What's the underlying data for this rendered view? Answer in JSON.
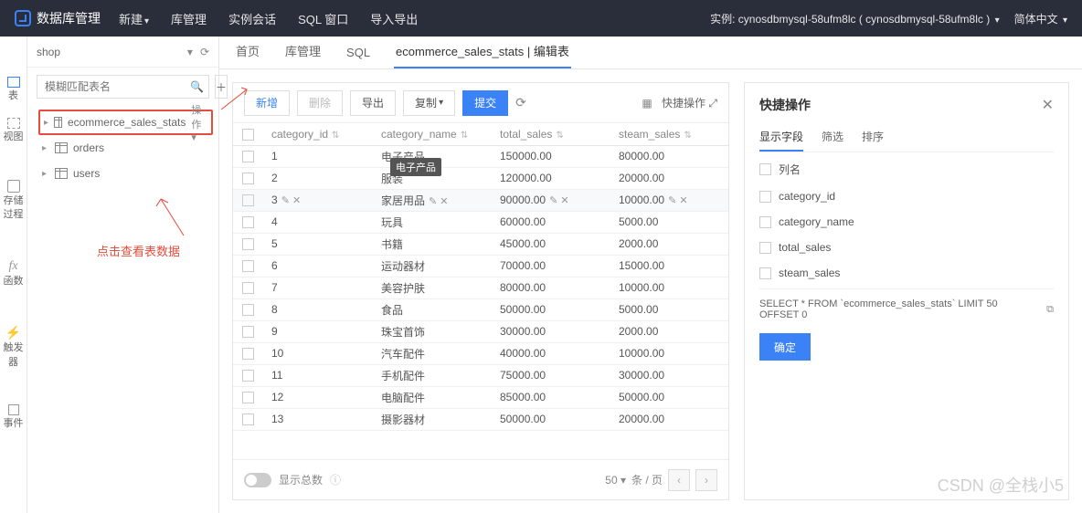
{
  "header": {
    "brand": "数据库管理",
    "menu": [
      "新建",
      "库管理",
      "实例会话",
      "SQL 窗口",
      "导入导出"
    ],
    "instance_label": "实例: cynosdbmysql-58ufm8lc ( cynosdbmysql-58ufm8lc )",
    "lang": "简体中文"
  },
  "sidebar": {
    "db": "shop",
    "search_placeholder": "模糊匹配表名",
    "tables": [
      {
        "name": "ecommerce_sales_stats",
        "action": "操作",
        "highlight": true
      },
      {
        "name": "orders"
      },
      {
        "name": "users"
      }
    ],
    "annotation": "点击查看表数据"
  },
  "rail": {
    "items": [
      "表",
      "视图",
      "存储过程",
      "函数",
      "触发器",
      "事件"
    ]
  },
  "tabs": {
    "items": [
      {
        "label": "首页"
      },
      {
        "label": "库管理"
      },
      {
        "label": "SQL"
      },
      {
        "label": "ecommerce_sales_stats | 编辑表",
        "active": true
      }
    ]
  },
  "toolbar": {
    "add": "新增",
    "delete": "删除",
    "export": "导出",
    "copy": "复制",
    "submit": "提交",
    "quick_label": "快捷操作"
  },
  "columns": [
    "category_id",
    "category_name",
    "total_sales",
    "steam_sales"
  ],
  "tooltip": "电子产品",
  "rows": [
    {
      "id": "1",
      "name": "电子产品",
      "total": "150000.00",
      "steam": "80000.00"
    },
    {
      "id": "2",
      "name": "服装",
      "total": "120000.00",
      "steam": "20000.00"
    },
    {
      "id": "3",
      "name": "家居用品",
      "total": "90000.00",
      "steam": "10000.00",
      "editing": true
    },
    {
      "id": "4",
      "name": "玩具",
      "total": "60000.00",
      "steam": "5000.00"
    },
    {
      "id": "5",
      "name": "书籍",
      "total": "45000.00",
      "steam": "2000.00"
    },
    {
      "id": "6",
      "name": "运动器材",
      "total": "70000.00",
      "steam": "15000.00"
    },
    {
      "id": "7",
      "name": "美容护肤",
      "total": "80000.00",
      "steam": "10000.00"
    },
    {
      "id": "8",
      "name": "食品",
      "total": "50000.00",
      "steam": "5000.00"
    },
    {
      "id": "9",
      "name": "珠宝首饰",
      "total": "30000.00",
      "steam": "2000.00"
    },
    {
      "id": "10",
      "name": "汽车配件",
      "total": "40000.00",
      "steam": "10000.00"
    },
    {
      "id": "11",
      "name": "手机配件",
      "total": "75000.00",
      "steam": "30000.00"
    },
    {
      "id": "12",
      "name": "电脑配件",
      "total": "85000.00",
      "steam": "50000.00"
    },
    {
      "id": "13",
      "name": "摄影器材",
      "total": "50000.00",
      "steam": "20000.00"
    }
  ],
  "pager": {
    "total_label": "显示总数",
    "page_size": "50",
    "per_page": "条 / 页"
  },
  "side": {
    "title": "快捷操作",
    "tabs": [
      "显示字段",
      "筛选",
      "排序"
    ],
    "fields": [
      "列名",
      "category_id",
      "category_name",
      "total_sales",
      "steam_sales"
    ],
    "sql": "SELECT * FROM `ecommerce_sales_stats` LIMIT 50 OFFSET 0",
    "confirm": "确定"
  },
  "watermark": "CSDN @全栈小5"
}
